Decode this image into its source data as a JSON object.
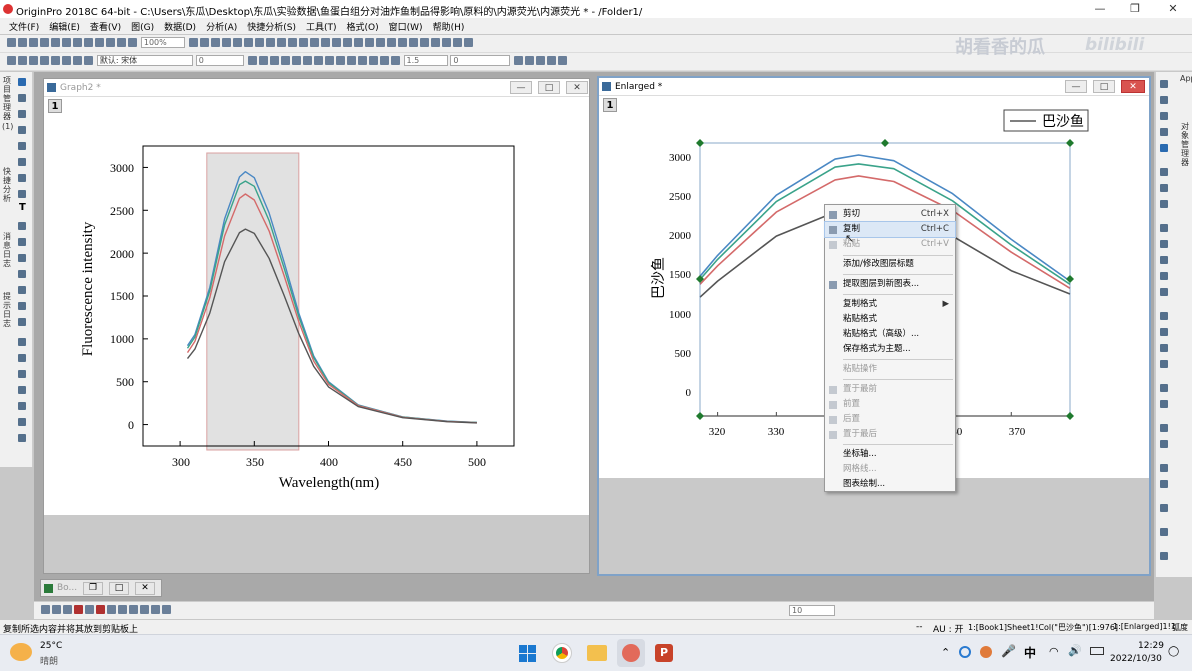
{
  "app": {
    "title": "OriginPro 2018C 64-bit - C:\\Users\\东瓜\\Desktop\\东瓜\\实验数据\\鱼蛋白组分对油炸鱼制品得影响\\原料的\\内源荧光\\内源荧光 * - /Folder1/",
    "controls": {
      "minimize": "—",
      "restore": "❐",
      "close": "✕"
    }
  },
  "menu": [
    "文件(F)",
    "编辑(E)",
    "查看(V)",
    "图(G)",
    "数据(D)",
    "分析(A)",
    "快捷分析(S)",
    "工具(T)",
    "格式(O)",
    "窗口(W)",
    "帮助(H)"
  ],
  "toolbar": {
    "zoom": "100%",
    "font": "默认: 宋体",
    "font_size": "0",
    "line_width": "1.5",
    "value_zero": "0",
    "bottom_size": "10",
    "watermark": "胡看香的瓜",
    "bili": "bilibili"
  },
  "side_labels": {
    "left": [
      "项目管理器",
      "(1)",
      "快捷分析",
      "消息日志",
      "提示日志"
    ],
    "right": [
      "Apps",
      "对象管理器"
    ]
  },
  "graph2": {
    "title": "Graph2 *",
    "layer": "1",
    "xlabel": "Wavelength(nm)",
    "ylabel": "Fluorescence intensity",
    "xticks": [
      "300",
      "350",
      "400",
      "450",
      "500"
    ],
    "yticks": [
      "0",
      "500",
      "1000",
      "1500",
      "2000",
      "2500",
      "3000"
    ]
  },
  "enlarged": {
    "title": "Enlarged *",
    "layer": "1",
    "legend": "巴沙鱼",
    "ylabel": "巴沙鱼",
    "xticks": [
      "320",
      "330",
      "350",
      "370"
    ],
    "yticks": [
      "0",
      "500",
      "1000",
      "1500",
      "2000",
      "2500",
      "3000"
    ]
  },
  "context_menu": {
    "items": [
      {
        "label": "剪切",
        "shortcut": "Ctrl+X",
        "disabled": false
      },
      {
        "label": "复制",
        "shortcut": "Ctrl+C",
        "disabled": false,
        "highlight": true
      },
      {
        "label": "粘贴",
        "shortcut": "Ctrl+V",
        "disabled": true
      },
      {
        "label": "添加/修改图层标题"
      },
      {
        "label": "提取图层到新图表..."
      },
      {
        "label": "复制格式",
        "submenu": true
      },
      {
        "label": "粘贴格式"
      },
      {
        "label": "粘贴格式（高级）..."
      },
      {
        "label": "保存格式为主题..."
      },
      {
        "label": "粘贴操作",
        "disabled": true
      },
      {
        "label": "置于最前",
        "disabled": true
      },
      {
        "label": "前置",
        "disabled": true
      },
      {
        "label": "后置",
        "disabled": true
      },
      {
        "label": "置于最后",
        "disabled": true
      },
      {
        "label": "坐标轴..."
      },
      {
        "label": "网格线...",
        "disabled": true
      },
      {
        "label": "图表绘制..."
      }
    ]
  },
  "minimized_window": {
    "title": "Bo..."
  },
  "status": {
    "left": "复制所选内容并将其放到剪贴板上",
    "dash": "--",
    "au": "AU : 开",
    "info": "1:[Book1]Sheet1!Col(\"巴沙鱼\")[1:976]",
    "layer": "1:[Enlarged]1!1",
    "unit": "弧度"
  },
  "taskbar": {
    "temp": "25°C",
    "weather": "晴朗",
    "ime": "中",
    "time": "12:29",
    "date": "2022/10/30"
  },
  "chart_data": [
    {
      "type": "line",
      "xlabel": "Wavelength(nm)",
      "ylabel": "Fluorescence intensity",
      "xlim": [
        275,
        525
      ],
      "ylim": [
        -250,
        3250
      ],
      "highlight_region": [
        318,
        380
      ],
      "series": [
        {
          "color": "#4a88c4",
          "x": [
            305,
            310,
            320,
            330,
            340,
            344,
            350,
            360,
            370,
            380,
            390,
            400,
            420,
            450,
            480,
            500
          ],
          "y": [
            920,
            1050,
            1600,
            2400,
            2890,
            2950,
            2880,
            2470,
            1900,
            1300,
            800,
            500,
            230,
            90,
            40,
            25
          ]
        },
        {
          "color": "#3aa38a",
          "x": [
            305,
            310,
            320,
            330,
            340,
            344,
            350,
            360,
            370,
            380,
            390,
            400,
            420,
            450,
            480,
            500
          ],
          "y": [
            890,
            1020,
            1560,
            2330,
            2800,
            2840,
            2780,
            2380,
            1830,
            1260,
            780,
            490,
            225,
            88,
            38,
            24
          ]
        },
        {
          "color": "#d46a6a",
          "x": [
            305,
            310,
            320,
            330,
            340,
            344,
            350,
            360,
            370,
            380,
            390,
            400,
            420,
            450,
            480,
            500
          ],
          "y": [
            840,
            970,
            1480,
            2200,
            2640,
            2690,
            2620,
            2260,
            1740,
            1200,
            740,
            470,
            220,
            85,
            36,
            22
          ]
        },
        {
          "color": "#555555",
          "x": [
            305,
            310,
            320,
            330,
            340,
            344,
            350,
            360,
            370,
            380,
            390,
            400,
            420,
            450,
            480,
            500
          ],
          "y": [
            770,
            880,
            1300,
            1900,
            2240,
            2280,
            2230,
            1940,
            1510,
            1060,
            680,
            440,
            210,
            80,
            34,
            20
          ]
        }
      ]
    },
    {
      "type": "line",
      "legend": [
        "巴沙鱼"
      ],
      "ylabel": "巴沙鱼",
      "xlim": [
        317,
        380
      ],
      "ylim": [
        -300,
        3100
      ],
      "series": [
        {
          "color": "#4a88c4",
          "x": [
            317,
            320,
            330,
            340,
            344,
            350,
            360,
            370,
            380
          ],
          "y": [
            1440,
            1700,
            2450,
            2900,
            2950,
            2880,
            2470,
            1900,
            1380
          ]
        },
        {
          "color": "#3aa38a",
          "x": [
            317,
            320,
            330,
            340,
            344,
            350,
            360,
            370,
            380
          ],
          "y": [
            1400,
            1650,
            2370,
            2800,
            2840,
            2780,
            2380,
            1830,
            1340
          ]
        },
        {
          "color": "#d46a6a",
          "x": [
            317,
            320,
            330,
            340,
            344,
            350,
            360,
            370,
            380
          ],
          "y": [
            1340,
            1570,
            2240,
            2640,
            2690,
            2620,
            2260,
            1740,
            1290
          ]
        },
        {
          "color": "#555555",
          "x": [
            317,
            320,
            330,
            340,
            344,
            350,
            360,
            370,
            380
          ],
          "y": [
            1180,
            1380,
            1940,
            2240,
            2280,
            2230,
            1940,
            1510,
            1220
          ]
        }
      ]
    }
  ]
}
